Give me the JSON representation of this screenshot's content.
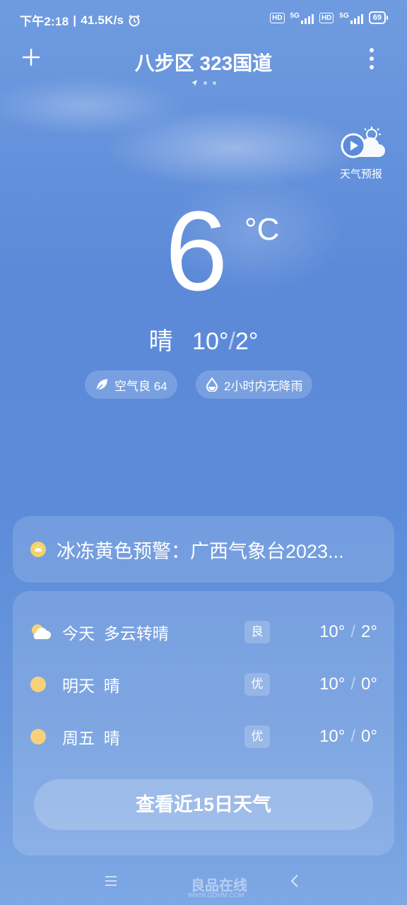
{
  "status": {
    "time": "下午2:18",
    "net_speed": "41.5K/s",
    "hd1": "HD",
    "g1": "5G",
    "hd2": "HD",
    "g2": "5G",
    "battery": "69"
  },
  "header": {
    "location": "八步区 323国道"
  },
  "forecast_video": {
    "label": "天气预报"
  },
  "current": {
    "temperature": "6",
    "unit": "°C",
    "condition": "晴",
    "high": "10°",
    "low": "2°"
  },
  "chips": {
    "air_quality": "空气良 64",
    "rain": "2小时内无降雨"
  },
  "alert": {
    "text": "冰冻黄色预警：广西气象台2023..."
  },
  "daily": [
    {
      "day": "今天",
      "condition": "多云转晴",
      "aqi": "良",
      "high": "10°",
      "low": "2°",
      "icon": "partly-cloudy-icon"
    },
    {
      "day": "明天",
      "condition": "晴",
      "aqi": "优",
      "high": "10°",
      "low": "0°",
      "icon": "sunny-icon"
    },
    {
      "day": "周五",
      "condition": "晴",
      "aqi": "优",
      "high": "10°",
      "low": "0°",
      "icon": "sunny-icon"
    }
  ],
  "daily_separator": "/",
  "view_15_days": "查看近15日天气",
  "watermark": {
    "text": "良品在线",
    "url": "WWW.GDMM.COM"
  }
}
